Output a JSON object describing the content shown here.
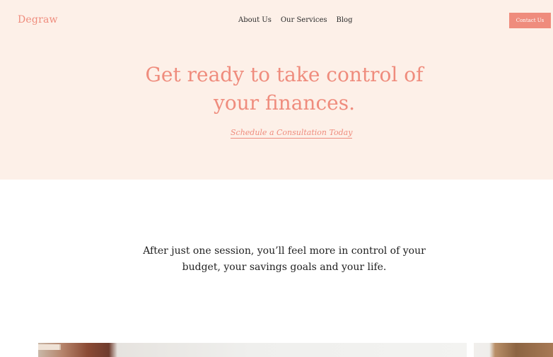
{
  "header": {
    "logo": "Degraw",
    "nav": [
      "About Us",
      "Our Services",
      "Blog"
    ],
    "contact_button": "Contact Us"
  },
  "hero": {
    "headline_line1": "Get ready to take control of",
    "headline_line2": "your finances.",
    "cta": "Schedule a Consultation Today"
  },
  "intro": {
    "line1": "After just one session, you’ll feel more in control of your",
    "line2": "budget, your savings goals and your life."
  },
  "colors": {
    "accent": "#ef8c7d",
    "hero_background": "#fdf0e8",
    "text": "#1f1f1f"
  }
}
